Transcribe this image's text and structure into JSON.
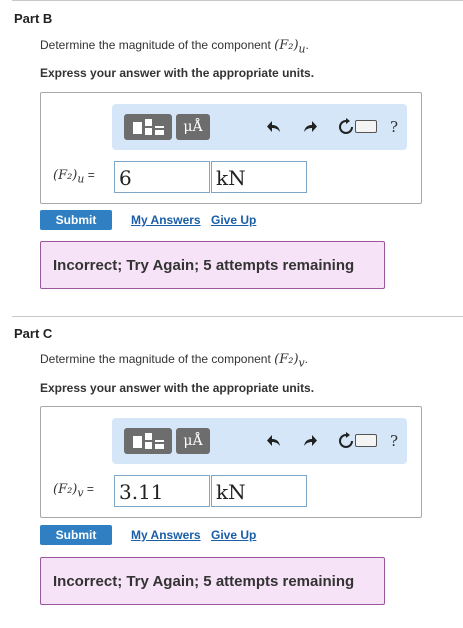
{
  "parts": [
    {
      "title": "Part B",
      "question_prefix": "Determine the magnitude of the component ",
      "question_math": "(F₂)",
      "question_sub": "u",
      "question_suffix": ".",
      "instruction": "Express your answer with the appropriate units.",
      "toolbar": {
        "mu_label": "μÅ",
        "help_label": "?"
      },
      "var_math": "(F₂)",
      "var_sub": "u",
      "equals": " =",
      "value": "6",
      "unit": "kN",
      "submit_label": "Submit",
      "my_answers_label": "My Answers",
      "give_up_label": "Give Up",
      "feedback": "Incorrect; Try Again; 5 attempts remaining"
    },
    {
      "title": "Part C",
      "question_prefix": "Determine the magnitude of the component ",
      "question_math": "(F₂)",
      "question_sub": "v",
      "question_suffix": ".",
      "instruction": "Express your answer with the appropriate units.",
      "toolbar": {
        "mu_label": "μÅ",
        "help_label": "?"
      },
      "var_math": "(F₂)",
      "var_sub": "v",
      "equals": " =",
      "value": "3.11",
      "unit": "kN",
      "submit_label": "Submit",
      "my_answers_label": "My Answers",
      "give_up_label": "Give Up",
      "feedback": "Incorrect; Try Again; 5 attempts remaining"
    }
  ],
  "colors": {
    "toolbar_bg": "#d4e6f8",
    "submit_bg": "#2f7fc2",
    "link": "#1a5ea8",
    "feedback_bg": "#f6e3f7",
    "feedback_border": "#9a579c"
  }
}
